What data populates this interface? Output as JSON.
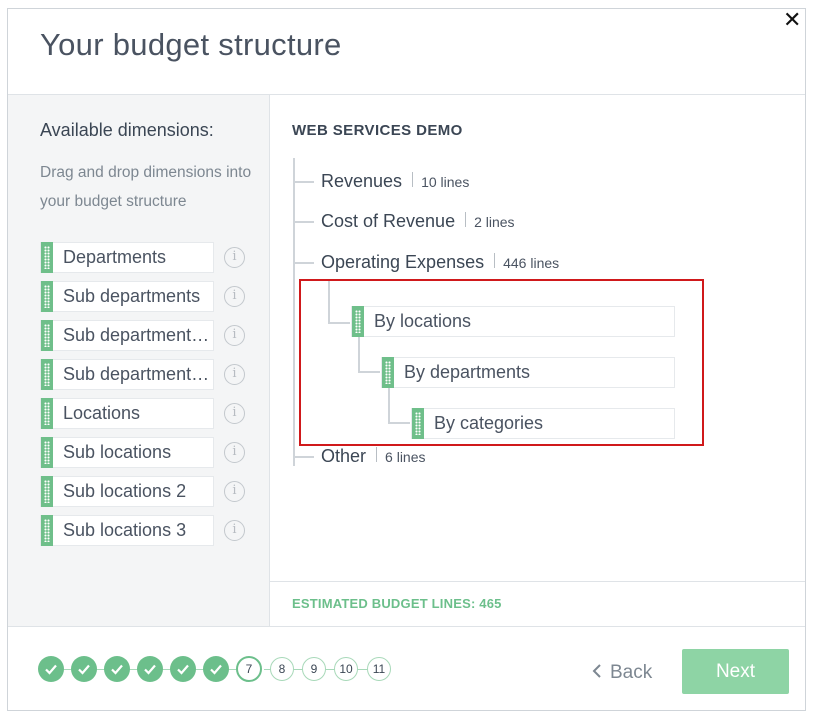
{
  "dialog": {
    "title": "Your budget structure",
    "close_glyph": "✕"
  },
  "left": {
    "heading": "Available dimensions:",
    "description": "Drag and drop dimensions into your budget structure",
    "dimensions": [
      {
        "label": "Departments"
      },
      {
        "label": "Sub departments"
      },
      {
        "label": "Sub department…"
      },
      {
        "label": "Sub department…"
      },
      {
        "label": "Locations"
      },
      {
        "label": "Sub locations"
      },
      {
        "label": "Sub locations 2"
      },
      {
        "label": "Sub locations 3"
      }
    ],
    "info_glyph": "i"
  },
  "structure": {
    "company": "WEB SERVICES DEMO",
    "nodes": [
      {
        "label": "Revenues",
        "count": "10 lines"
      },
      {
        "label": "Cost of Revenue",
        "count": "2 lines"
      },
      {
        "label": "Operating Expenses",
        "count": "446 lines"
      },
      {
        "label": "Other",
        "count": "6 lines"
      }
    ],
    "breakdown": [
      {
        "label": "By locations"
      },
      {
        "label": "By departments"
      },
      {
        "label": "By categories"
      }
    ],
    "estimate": "ESTIMATED BUDGET LINES: 465"
  },
  "stepper": {
    "completed_steps": 6,
    "current": "7",
    "upcoming": [
      "8",
      "9",
      "10",
      "11"
    ]
  },
  "actions": {
    "back_label": "Back",
    "next_label": "Next"
  },
  "colors": {
    "accent": "#6cbf8b",
    "next_button": "#8ed4a5",
    "highlight_border": "#d0191b"
  }
}
